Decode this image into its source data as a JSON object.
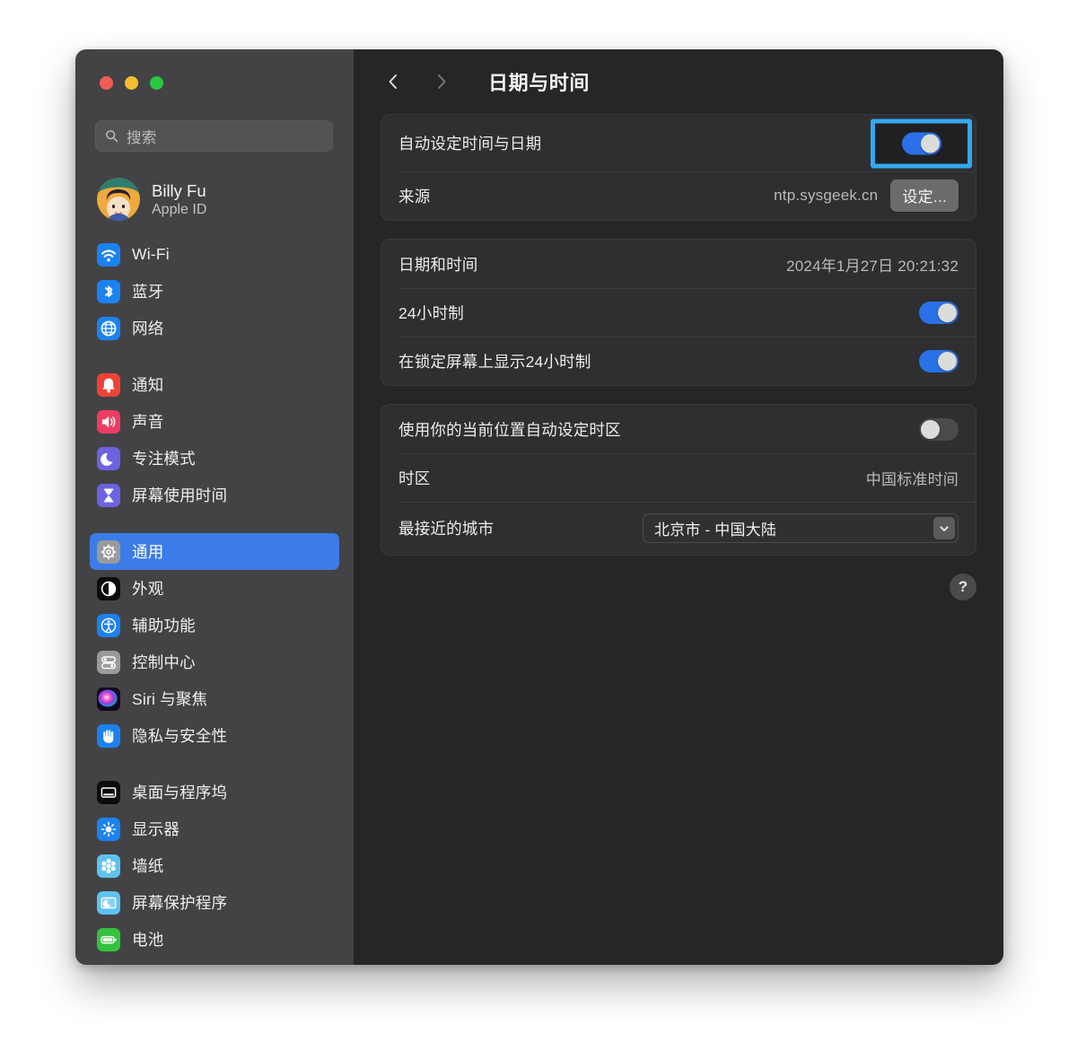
{
  "window": {
    "traffic_lights": [
      {
        "name": "close",
        "color": "#f35c52"
      },
      {
        "name": "minimize",
        "color": "#f7bd2e"
      },
      {
        "name": "maximize",
        "color": "#29c840"
      }
    ]
  },
  "sidebar": {
    "search": {
      "placeholder": "搜索",
      "value": ""
    },
    "account": {
      "name": "Billy Fu",
      "subtitle": "Apple ID"
    },
    "groups": [
      {
        "items": [
          {
            "label": "Wi-Fi",
            "icon": "wifi-icon",
            "selected": false
          },
          {
            "label": "蓝牙",
            "icon": "bluetooth-icon",
            "selected": false
          },
          {
            "label": "网络",
            "icon": "network-icon",
            "selected": false
          }
        ]
      },
      {
        "items": [
          {
            "label": "通知",
            "icon": "notifications-icon",
            "selected": false
          },
          {
            "label": "声音",
            "icon": "sound-icon",
            "selected": false
          },
          {
            "label": "专注模式",
            "icon": "focus-icon",
            "selected": false
          },
          {
            "label": "屏幕使用时间",
            "icon": "screen-time-icon",
            "selected": false
          }
        ]
      },
      {
        "items": [
          {
            "label": "通用",
            "icon": "general-gear-icon",
            "selected": true
          },
          {
            "label": "外观",
            "icon": "appearance-icon",
            "selected": false
          },
          {
            "label": "辅助功能",
            "icon": "accessibility-icon",
            "selected": false
          },
          {
            "label": "控制中心",
            "icon": "control-center-icon",
            "selected": false
          },
          {
            "label": "Siri 与聚焦",
            "icon": "siri-icon",
            "selected": false
          },
          {
            "label": "隐私与安全性",
            "icon": "privacy-hand-icon",
            "selected": false
          }
        ]
      },
      {
        "items": [
          {
            "label": "桌面与程序坞",
            "icon": "desktop-dock-icon",
            "selected": false
          },
          {
            "label": "显示器",
            "icon": "displays-icon",
            "selected": false
          },
          {
            "label": "墙纸",
            "icon": "wallpaper-icon",
            "selected": false
          },
          {
            "label": "屏幕保护程序",
            "icon": "screensaver-icon",
            "selected": false
          },
          {
            "label": "电池",
            "icon": "battery-icon",
            "selected": false
          }
        ]
      }
    ]
  },
  "main": {
    "nav": {
      "back": "‹",
      "forward": "›"
    },
    "title": "日期与时间",
    "cards": [
      {
        "rows": [
          {
            "label": "自动设定时间与日期",
            "control": "toggle",
            "toggle_on": true,
            "highlighted": true
          },
          {
            "label": "来源",
            "value": "ntp.sysgeek.cn",
            "control": "button",
            "button_label": "设定..."
          }
        ]
      },
      {
        "rows": [
          {
            "label": "日期和时间",
            "value": "2024年1月27日 20:21:32",
            "control": "none"
          },
          {
            "label": "24小时制",
            "control": "toggle",
            "toggle_on": true,
            "highlighted": false
          },
          {
            "label": "在锁定屏幕上显示24小时制",
            "control": "toggle",
            "toggle_on": true,
            "highlighted": false
          }
        ]
      },
      {
        "rows": [
          {
            "label": "使用你的当前位置自动设定时区",
            "control": "toggle",
            "toggle_on": false,
            "highlighted": false
          },
          {
            "label": "时区",
            "value": "中国标准时间",
            "control": "none"
          },
          {
            "label": "最接近的城市",
            "control": "popup",
            "popup_value": "北京市 - 中国大陆"
          }
        ]
      }
    ],
    "help_label": "?"
  },
  "colors": {
    "accent_blue": "#3c7ce8",
    "toggle_on": "#2a71e8",
    "highlight_ring": "#35a8ee",
    "sidebar_bg": "#434345",
    "panel_bg": "#262628",
    "card_bg": "#2f2f31"
  }
}
